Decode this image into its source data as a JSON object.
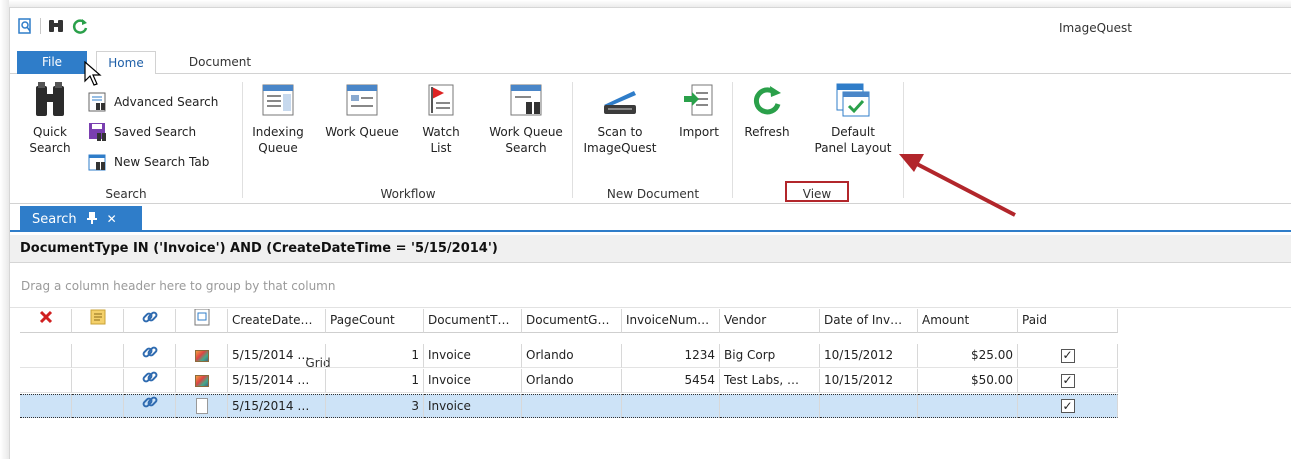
{
  "app": {
    "title": "ImageQuest"
  },
  "quick_access": [
    {
      "name": "app-menu-icon"
    },
    {
      "name": "binoculars-icon"
    },
    {
      "name": "refresh-icon"
    }
  ],
  "ribbon_tabs": {
    "file": "File",
    "home": "Home",
    "document": "Document",
    "grid": "Grid"
  },
  "ribbon": {
    "search_group": {
      "label": "Search",
      "quick_search": [
        "Quick",
        "Search"
      ],
      "advanced_search": "Advanced Search",
      "saved_search": "Saved Search",
      "new_search_tab": "New Search Tab"
    },
    "workflow_group": {
      "label": "Workflow",
      "indexing_queue": [
        "Indexing",
        "Queue"
      ],
      "work_queue": "Work Queue",
      "watch_list": [
        "Watch",
        "List"
      ],
      "work_queue_search": [
        "Work Queue",
        "Search"
      ]
    },
    "new_document_group": {
      "label": "New Document",
      "scan": [
        "Scan to",
        "ImageQuest"
      ],
      "import": "Import"
    },
    "view_group": {
      "label": "View",
      "refresh": "Refresh",
      "default_panel_layout": [
        "Default",
        "Panel Layout"
      ]
    }
  },
  "doc_tab": {
    "label": "Search",
    "pin": "⫫",
    "close": "✕"
  },
  "filter": {
    "text": "DocumentType IN ('Invoice') AND (CreateDateTime = '5/15/2014')"
  },
  "grid": {
    "group_hint": "Drag a column header here to group by that column",
    "headers": [
      "CreateDate…",
      "PageCount",
      "DocumentT…",
      "DocumentG…",
      "InvoiceNum…",
      "Vendor",
      "Date of Inv…",
      "Amount",
      "Paid"
    ],
    "rows": [
      {
        "create": "5/15/2014 …",
        "pages": "1",
        "type": "Invoice",
        "group": "Orlando",
        "invoice": "1234",
        "vendor": "Big Corp",
        "date": "10/15/2012",
        "amount": "$25.00",
        "paid": "✓"
      },
      {
        "create": "5/15/2014 …",
        "pages": "1",
        "type": "Invoice",
        "group": "Orlando",
        "invoice": "5454",
        "vendor": "Test Labs, …",
        "date": "10/15/2012",
        "amount": "$50.00",
        "paid": "✓"
      },
      {
        "create": "5/15/2014 …",
        "pages": "3",
        "type": "Invoice",
        "group": "",
        "invoice": "",
        "vendor": "",
        "date": "",
        "amount": "",
        "paid": "✓"
      }
    ]
  },
  "colors": {
    "accent": "#2f7dc9",
    "selected_row": "#cde3f7",
    "annotation": "#b2262b"
  }
}
